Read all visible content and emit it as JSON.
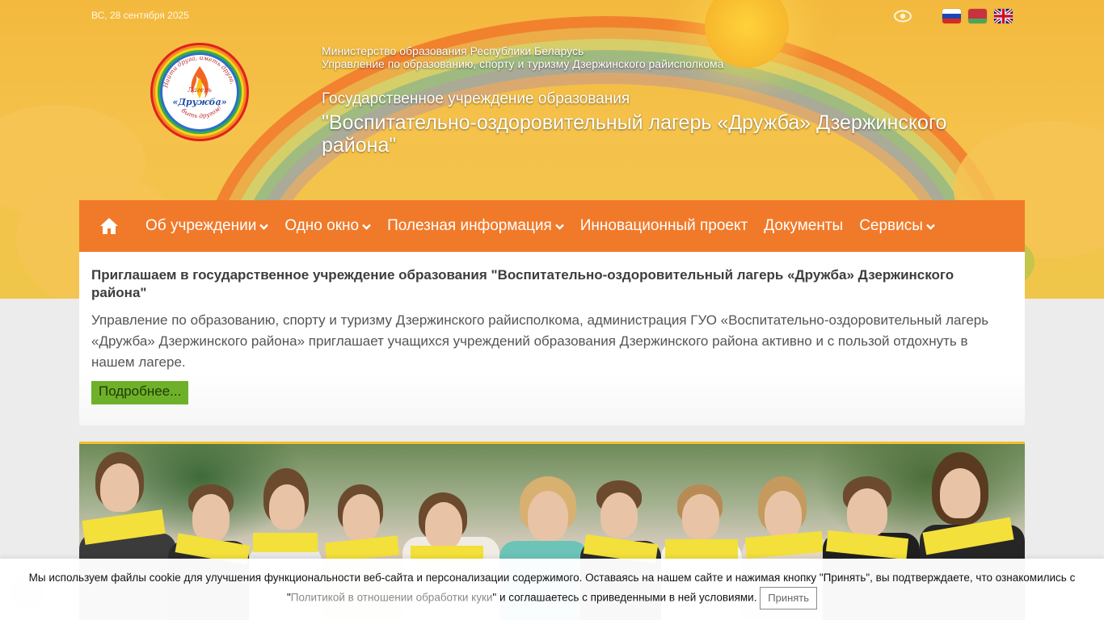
{
  "topbar": {
    "date": "ВС, 28 сентября 2025",
    "flags": [
      {
        "name": "flag-ru",
        "stripes": [
          "#ffffff",
          "#1c46b8",
          "#d52b1e"
        ]
      },
      {
        "name": "flag-by",
        "stripes": [
          "#c8313e",
          "#c8313e",
          "#4aa657"
        ]
      },
      {
        "name": "flag-en",
        "stripes": [
          "#012169",
          "#ffffff",
          "#c8102e"
        ]
      }
    ]
  },
  "header": {
    "ministry_line1": "Министерство образования Республики Беларусь",
    "ministry_line2": "Управление по образованию, спорту и туризму Дзержинского райисполкома",
    "institution_type": "Государственное учреждение образования",
    "institution_name": "\"Воспитательно-оздоровительный лагерь «Дружба» Дзержинского района\"",
    "logo": {
      "arc_top": "Найти друга, иметь друга,",
      "arc_bottom": "быть другом!",
      "center_top": "Лагерь",
      "center_main": "«Дружба»"
    }
  },
  "nav": {
    "items": [
      {
        "label": "Об учреждении",
        "dropdown": true
      },
      {
        "label": "Одно окно",
        "dropdown": true
      },
      {
        "label": "Полезная информация",
        "dropdown": true
      },
      {
        "label": "Инновационный проект",
        "dropdown": false
      },
      {
        "label": "Документы",
        "dropdown": false
      },
      {
        "label": "Сервисы",
        "dropdown": true
      }
    ]
  },
  "announcement": {
    "title": "Приглашаем в государственное учреждение образования \"Воспитательно-оздоровительный лагерь «Дружба» Дзержинского района\"",
    "body": "Управление по образованию, спорту и туризму Дзержинского райисполкома, администрация ГУО «Воспитательно-оздоровительный лагерь «Дружба» Дзержинского района» приглашает учащихся учреждений образования Дзержинского района активно и с пользой отдохнуть в нашем лагере.",
    "more_label": "Подробнее..."
  },
  "cookie": {
    "text_before": "Мы используем файлы cookie для улучшения функциональности веб-сайта и персонализации содержимого. Оставаясь на нашем сайте и нажимая кнопку \"Принять\", вы подтверждаете, что ознакомились с \"",
    "link": "Политикой в отношении обработки куки",
    "text_after": "\" и соглашаетесь с приведенными в ней условиями.",
    "accept_label": "Принять"
  },
  "colors": {
    "nav": "#f07a2a",
    "accent_green": "#6fb02a",
    "photo_border": "#f2bf2e"
  }
}
